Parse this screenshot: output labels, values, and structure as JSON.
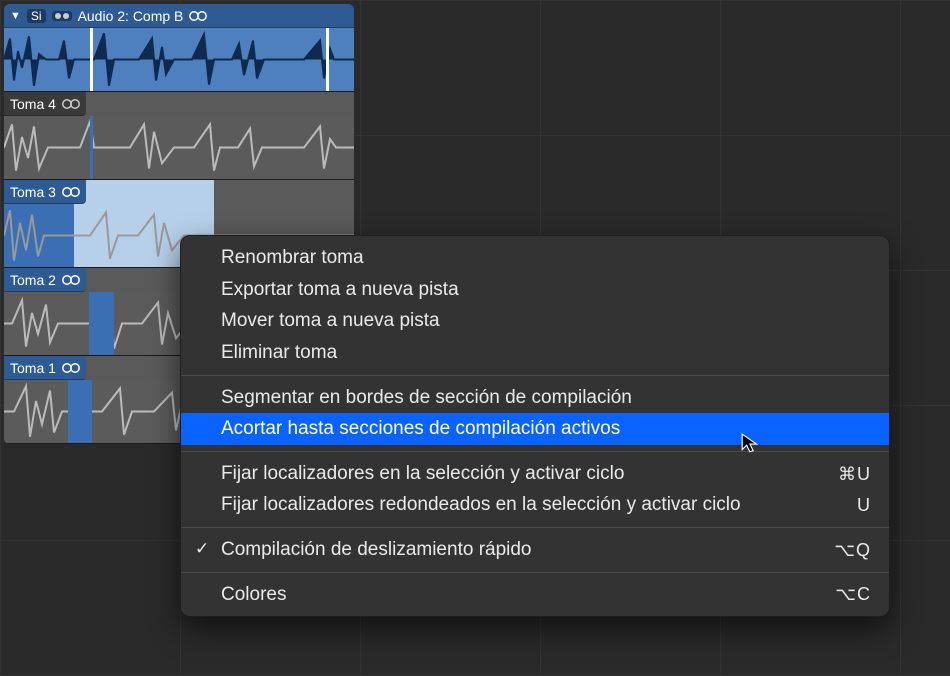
{
  "header": {
    "disclosure": "▼",
    "si_label": "Si",
    "title": "Audio 2: Comp B"
  },
  "takes": [
    {
      "label": "Toma 4",
      "highlights": []
    },
    {
      "label": "Toma 3",
      "highlights": [
        [
          0,
          70
        ]
      ],
      "selected_region": [
        0,
        210
      ]
    },
    {
      "label": "Toma 2",
      "highlights": [
        [
          85,
          25
        ]
      ]
    },
    {
      "label": "Toma 1",
      "highlights": [
        [
          64,
          24
        ]
      ]
    }
  ],
  "menu": {
    "group1": [
      {
        "label": "Renombrar toma"
      },
      {
        "label": "Exportar toma a nueva pista"
      },
      {
        "label": "Mover toma a nueva pista"
      },
      {
        "label": "Eliminar toma"
      }
    ],
    "group2": [
      {
        "label": "Segmentar en bordes de sección de compilación"
      },
      {
        "label": "Acortar hasta secciones de compilación activos",
        "hovered": true
      }
    ],
    "group3": [
      {
        "label": "Fijar localizadores en la selección y activar ciclo",
        "shortcut": "⌘U"
      },
      {
        "label": "Fijar localizadores redondeados en la selección y activar ciclo",
        "shortcut": "U"
      }
    ],
    "group4": [
      {
        "label": "Compilación de deslizamiento rápido",
        "checked": true,
        "shortcut": "⌥Q"
      }
    ],
    "group5": [
      {
        "label": "Colores",
        "shortcut": "⌥C"
      }
    ]
  }
}
